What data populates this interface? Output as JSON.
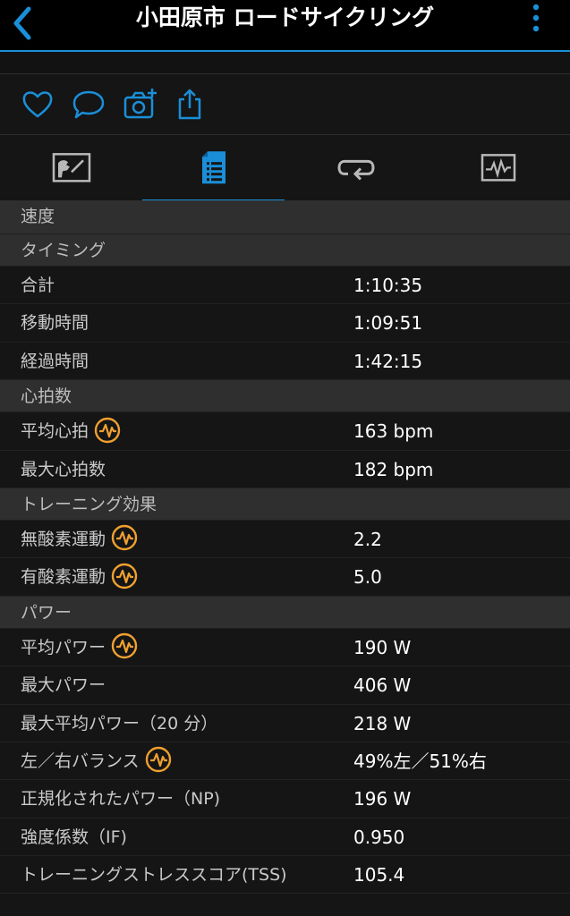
{
  "header": {
    "title": "小田原市 ロードサイクリング"
  },
  "sections": [
    {
      "title": "速度",
      "rows": []
    },
    {
      "title": "タイミング",
      "rows": [
        {
          "label": "合計",
          "value": "1:10:35",
          "badge": false
        },
        {
          "label": "移動時間",
          "value": "1:09:51",
          "badge": false
        },
        {
          "label": "経過時間",
          "value": "1:42:15",
          "badge": false
        }
      ]
    },
    {
      "title": "心拍数",
      "rows": [
        {
          "label": "平均心拍",
          "value": "163 bpm",
          "badge": true
        },
        {
          "label": "最大心拍数",
          "value": "182 bpm",
          "badge": false
        }
      ]
    },
    {
      "title": "トレーニング効果",
      "rows": [
        {
          "label": "無酸素運動",
          "value": "2.2",
          "badge": true
        },
        {
          "label": "有酸素運動",
          "value": "5.0",
          "badge": true
        }
      ]
    },
    {
      "title": "パワー",
      "rows": [
        {
          "label": "平均パワー",
          "value": "190 W",
          "badge": true
        },
        {
          "label": "最大パワー",
          "value": "406 W",
          "badge": false
        },
        {
          "label": "最大平均パワー（20 分）",
          "value": "218 W",
          "badge": false
        },
        {
          "label": "左／右バランス",
          "value": "49%左／51%右",
          "badge": true
        },
        {
          "label": "正規化されたパワー（NP)",
          "value": "196 W",
          "badge": false
        },
        {
          "label": "強度係数（IF)",
          "value": "0.950",
          "badge": false
        },
        {
          "label": "トレーニングストレススコア(TSS)",
          "value": "105.4",
          "badge": false
        }
      ]
    }
  ],
  "icons": {
    "back": "chevron-left-icon",
    "menu": "more-vertical-icon",
    "actions": [
      "heart-icon",
      "comment-icon",
      "add-photo-icon",
      "share-icon"
    ],
    "tabs": [
      "map-icon",
      "stats-list-icon",
      "laps-icon",
      "chart-icon"
    ],
    "badge": "heart-rate-sensor-icon"
  },
  "colors": {
    "accent": "#1a8fd8",
    "badge": "#f0a030"
  }
}
